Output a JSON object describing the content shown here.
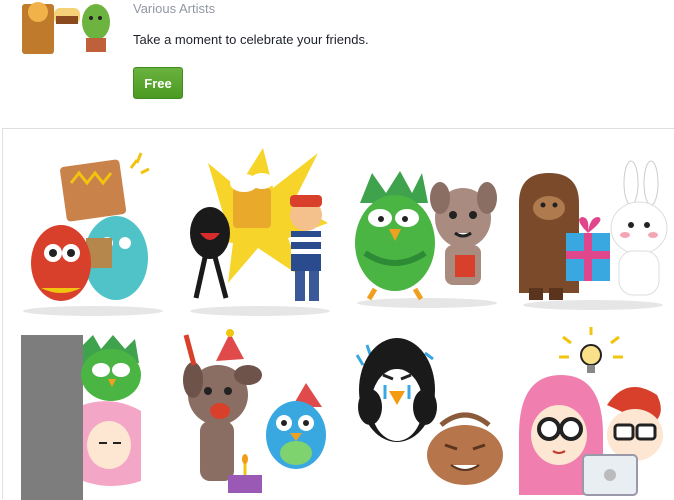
{
  "pack": {
    "artist": "Various Artists",
    "description": "Take a moment to celebrate your friends.",
    "price_label": "Free"
  },
  "stickers": [
    {
      "name": "monster-pair-sticker"
    },
    {
      "name": "devil-and-kid-cheers-sticker"
    },
    {
      "name": "owl-and-bulldog-sticker"
    },
    {
      "name": "bigfoot-and-bunny-gift-sticker"
    },
    {
      "name": "peeking-owl-and-girl-sticker"
    },
    {
      "name": "dog-and-bird-party-sticker"
    },
    {
      "name": "crying-penguin-sticker"
    },
    {
      "name": "idea-kids-sticker"
    }
  ]
}
